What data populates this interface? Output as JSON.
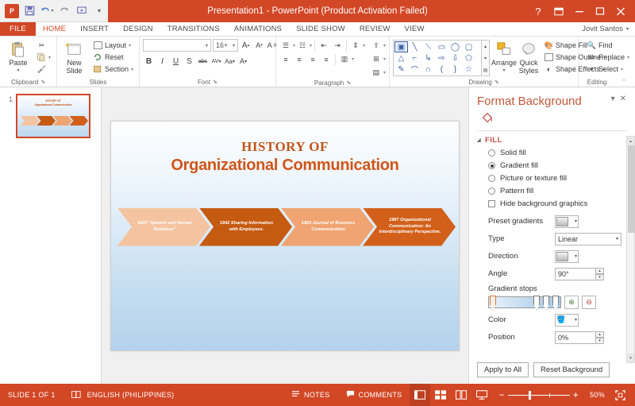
{
  "titlebar": {
    "app_title": "Presentation1  -  PowerPoint (Product Activation Failed)",
    "qat": [
      {
        "name": "powerpoint-logo",
        "glyph": "P"
      },
      {
        "name": "save-icon",
        "glyph": "ὋE"
      },
      {
        "name": "undo-icon",
        "glyph": "↶"
      },
      {
        "name": "redo-icon",
        "glyph": "↻"
      },
      {
        "name": "start-slideshow-icon",
        "glyph": "❐"
      },
      {
        "name": "customize-qat-icon",
        "glyph": "≡"
      }
    ],
    "window_controls": [
      {
        "name": "help-button",
        "glyph": "?"
      },
      {
        "name": "ribbon-display-options-button",
        "glyph": "⛶"
      },
      {
        "name": "minimize-button",
        "glyph": "–"
      },
      {
        "name": "maximize-button",
        "glyph": "☐"
      },
      {
        "name": "close-button",
        "glyph": "✕"
      }
    ]
  },
  "tabs": {
    "file_label": "FILE",
    "items": [
      "HOME",
      "INSERT",
      "DESIGN",
      "TRANSITIONS",
      "ANIMATIONS",
      "SLIDE SHOW",
      "REVIEW",
      "VIEW"
    ],
    "active": "HOME",
    "user_name": "Jovit Santos"
  },
  "ribbon": {
    "clipboard": {
      "label": "Clipboard",
      "paste_label": "Paste",
      "buttons": [
        "Cut",
        "Copy",
        "Format Painter"
      ]
    },
    "slides": {
      "label": "Slides",
      "new_slide_label": "New\nSlide",
      "new_slide_line1": "New",
      "new_slide_line2": "Slide",
      "layout_label": "Layout",
      "reset_label": "Reset",
      "section_label": "Section"
    },
    "font": {
      "label": "Font",
      "font_name": "",
      "font_size": "16+",
      "grow_label": "A",
      "shrink_label": "A",
      "clear_format_label": "A",
      "bold": "B",
      "italic": "I",
      "underline": "U",
      "shadow": "S",
      "strikethrough": "abc",
      "spacing": "AV",
      "case": "Aa",
      "color": "A"
    },
    "paragraph": {
      "label": "Paragraph"
    },
    "drawing": {
      "label": "Drawing",
      "arrange_label": "Arrange",
      "quick_styles_line1": "Quick",
      "quick_styles_line2": "Styles",
      "shape_fill_label": "Shape Fill",
      "shape_outline_label": "Shape Outline",
      "shape_effects_label": "Shape Effects"
    },
    "editing": {
      "label": "Editing",
      "find_label": "Find",
      "replace_label": "Replace",
      "select_label": "Select"
    }
  },
  "thumbnails": {
    "slides": [
      {
        "number": "1",
        "title_line1": "HISTORY OF",
        "title_line2": "Organizational Communication"
      }
    ]
  },
  "slide": {
    "title_line1": "HISTORY OF",
    "title_line2": "Organizational Communication",
    "chevrons": [
      {
        "text": "1937 “Speech and Human Relations”",
        "color": "#f4c3a0"
      },
      {
        "text": "1942 Sharing Information with Employees.",
        "color": "#c55a11"
      },
      {
        "text": "1963 Journal of Business Communication",
        "color": "#f0a472"
      },
      {
        "text": "1987 Organizational Communication: An Interdisciplinary Perspective.",
        "color": "#d2601a"
      }
    ]
  },
  "format_background": {
    "title": "Format Background",
    "section_fill": "FILL",
    "options": [
      {
        "label": "Solid fill",
        "selected": false
      },
      {
        "label": "Gradient fill",
        "selected": true
      },
      {
        "label": "Picture or texture fill",
        "selected": false
      },
      {
        "label": "Pattern fill",
        "selected": false
      }
    ],
    "hide_bg_label": "Hide background graphics",
    "preset_gradients_label": "Preset gradients",
    "type_label": "Type",
    "type_value": "Linear",
    "direction_label": "Direction",
    "angle_label": "Angle",
    "angle_value": "90°",
    "gradient_stops_label": "Gradient stops",
    "color_label": "Color",
    "position_label": "Position",
    "position_value": "0%",
    "apply_to_all_label": "Apply to All",
    "reset_background_label": "Reset Background"
  },
  "statusbar": {
    "slide_count": "SLIDE 1 OF 1",
    "language": "ENGLISH (PHILIPPINES)",
    "notes_label": "NOTES",
    "comments_label": "COMMENTS",
    "zoom_level": "50%"
  },
  "colors": {
    "accent": "#d24726",
    "title_orange": "#c1541b"
  }
}
